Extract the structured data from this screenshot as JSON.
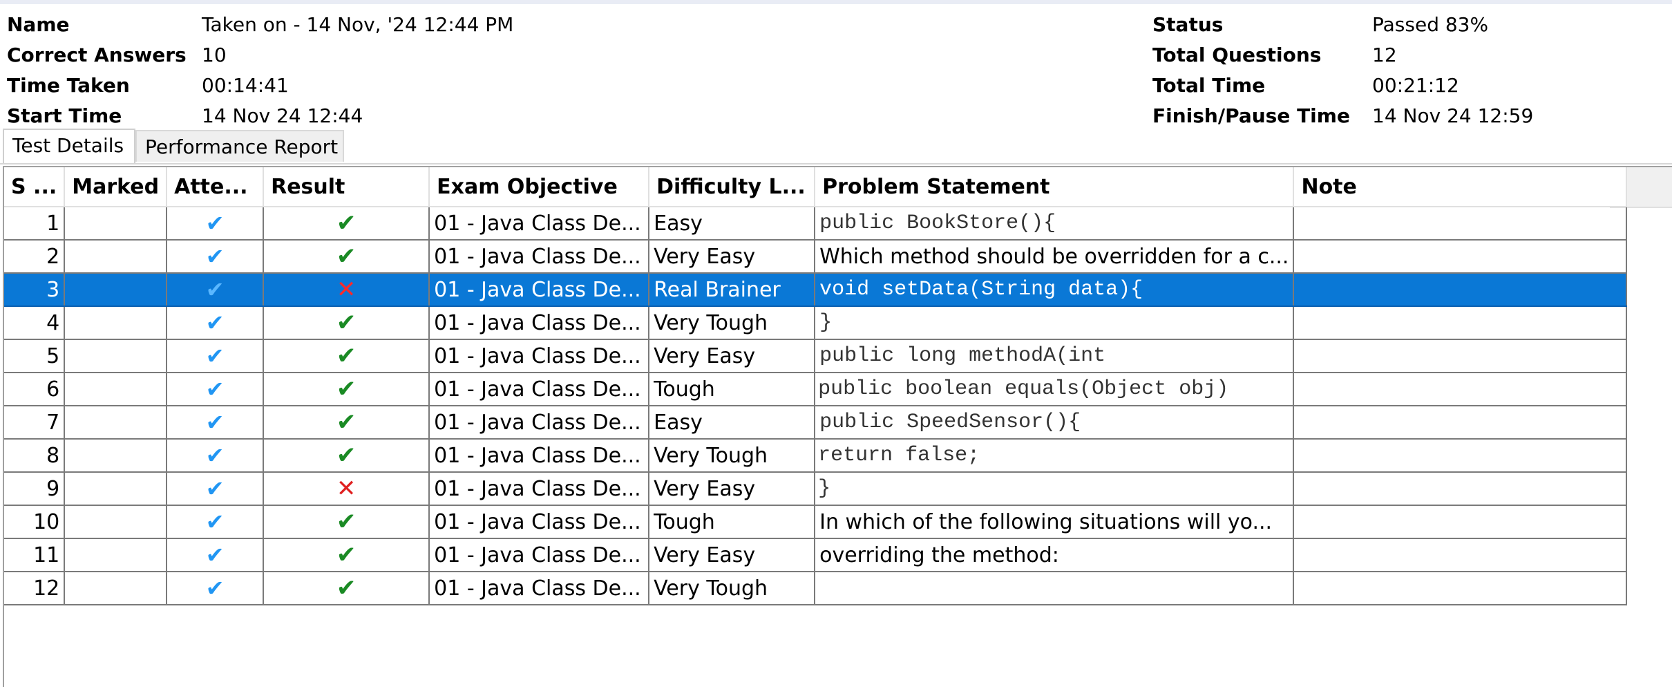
{
  "summary": {
    "left": [
      {
        "label": "Name",
        "value": "Taken on - 14 Nov, '24 12:44 PM"
      },
      {
        "label": "Correct Answers",
        "value": "10"
      },
      {
        "label": "Time Taken",
        "value": "00:14:41"
      },
      {
        "label": "Start Time",
        "value": "14 Nov 24 12:44"
      }
    ],
    "right": [
      {
        "label": "Status",
        "value": "Passed 83%"
      },
      {
        "label": "Total Questions",
        "value": "12"
      },
      {
        "label": "Total Time",
        "value": "00:21:12"
      },
      {
        "label": "Finish/Pause Time",
        "value": "14 Nov 24 12:59"
      }
    ]
  },
  "tabs": [
    {
      "label": "Test Details",
      "active": true
    },
    {
      "label": "Performance Report",
      "active": false
    }
  ],
  "table": {
    "headers": [
      "S ...",
      "Marked",
      "Atte...",
      "Result",
      "Exam Objective",
      "Difficulty L...",
      "Problem Statement",
      "Note"
    ],
    "selected_row": 3,
    "rows": [
      {
        "sn": "1",
        "marked": "",
        "attempted": "✔",
        "result": "✔",
        "objective": "01 - Java Class De...",
        "difficulty": "Easy",
        "problem": "public BookStore(){",
        "note": ""
      },
      {
        "sn": "2",
        "marked": "",
        "attempted": "✔",
        "result": "✔",
        "objective": "01 - Java Class De...",
        "difficulty": "Very Easy",
        "problem": "Which method should be overridden for a c...",
        "note": ""
      },
      {
        "sn": "3",
        "marked": "",
        "attempted": "✔",
        "result": "✕",
        "objective": "01 - Java Class De...",
        "difficulty": "Real Brainer",
        "problem": "void setData(String data){",
        "note": ""
      },
      {
        "sn": "4",
        "marked": "",
        "attempted": "✔",
        "result": "✔",
        "objective": "01 - Java Class De...",
        "difficulty": "Very Tough",
        "problem": "}",
        "note": ""
      },
      {
        "sn": "5",
        "marked": "",
        "attempted": "✔",
        "result": "✔",
        "objective": "01 - Java Class De...",
        "difficulty": "Very Easy",
        "problem": "public long methodA(int",
        "note": ""
      },
      {
        "sn": "6",
        "marked": "",
        "attempted": "✔",
        "result": "✔",
        "objective": "01 - Java Class De...",
        "difficulty": "Tough",
        "problem": "public boolean equals(Object obj)",
        "note": ""
      },
      {
        "sn": "7",
        "marked": "",
        "attempted": "✔",
        "result": "✔",
        "objective": "01 - Java Class De...",
        "difficulty": "Easy",
        "problem": "public SpeedSensor(){",
        "note": ""
      },
      {
        "sn": "8",
        "marked": "",
        "attempted": "✔",
        "result": "✔",
        "objective": "01 - Java Class De...",
        "difficulty": "Very Tough",
        "problem": "return false;",
        "note": ""
      },
      {
        "sn": "9",
        "marked": "",
        "attempted": "✔",
        "result": "✕",
        "objective": "01 - Java Class De...",
        "difficulty": "Very Easy",
        "problem": "}",
        "note": ""
      },
      {
        "sn": "10",
        "marked": "",
        "attempted": "✔",
        "result": "✔",
        "objective": "01 - Java Class De...",
        "difficulty": "Tough",
        "problem": "In which of the following situations will yo...",
        "note": ""
      },
      {
        "sn": "11",
        "marked": "",
        "attempted": "✔",
        "result": "✔",
        "objective": "01 - Java Class De...",
        "difficulty": "Very Easy",
        "problem": "overriding the method:",
        "note": ""
      },
      {
        "sn": "12",
        "marked": "",
        "attempted": "✔",
        "result": "✔",
        "objective": "01 - Java Class De...",
        "difficulty": "Very Tough",
        "problem": "",
        "note": ""
      }
    ]
  },
  "colors": {
    "selected_row": "#0a78d6",
    "check": "#1a8a24",
    "attempt": "#2196f3",
    "cross": "#e02020"
  },
  "icons": {
    "attempted": "check-icon",
    "correct": "check-icon",
    "wrong": "cross-icon"
  }
}
